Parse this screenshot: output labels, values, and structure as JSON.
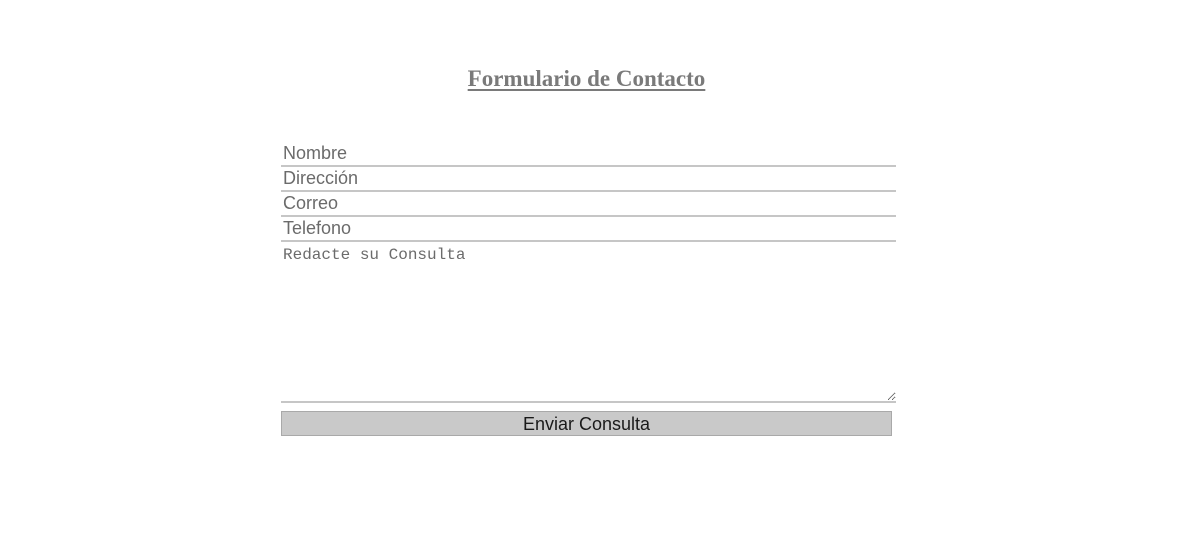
{
  "form": {
    "title": "Formulario de Contacto",
    "fields": {
      "nombre": {
        "placeholder": "Nombre",
        "value": ""
      },
      "direccion": {
        "placeholder": "Dirección",
        "value": ""
      },
      "correo": {
        "placeholder": "Correo",
        "value": ""
      },
      "telefono": {
        "placeholder": "Telefono",
        "value": ""
      }
    },
    "message": {
      "placeholder": "Redacte su Consulta",
      "value": ""
    },
    "submit_label": "Enviar Consulta"
  },
  "colors": {
    "title": "#7a7a7a",
    "field_text": "#6b6b6b",
    "field_border": "#c6c6c6",
    "button_background": "#c9c9c9"
  }
}
